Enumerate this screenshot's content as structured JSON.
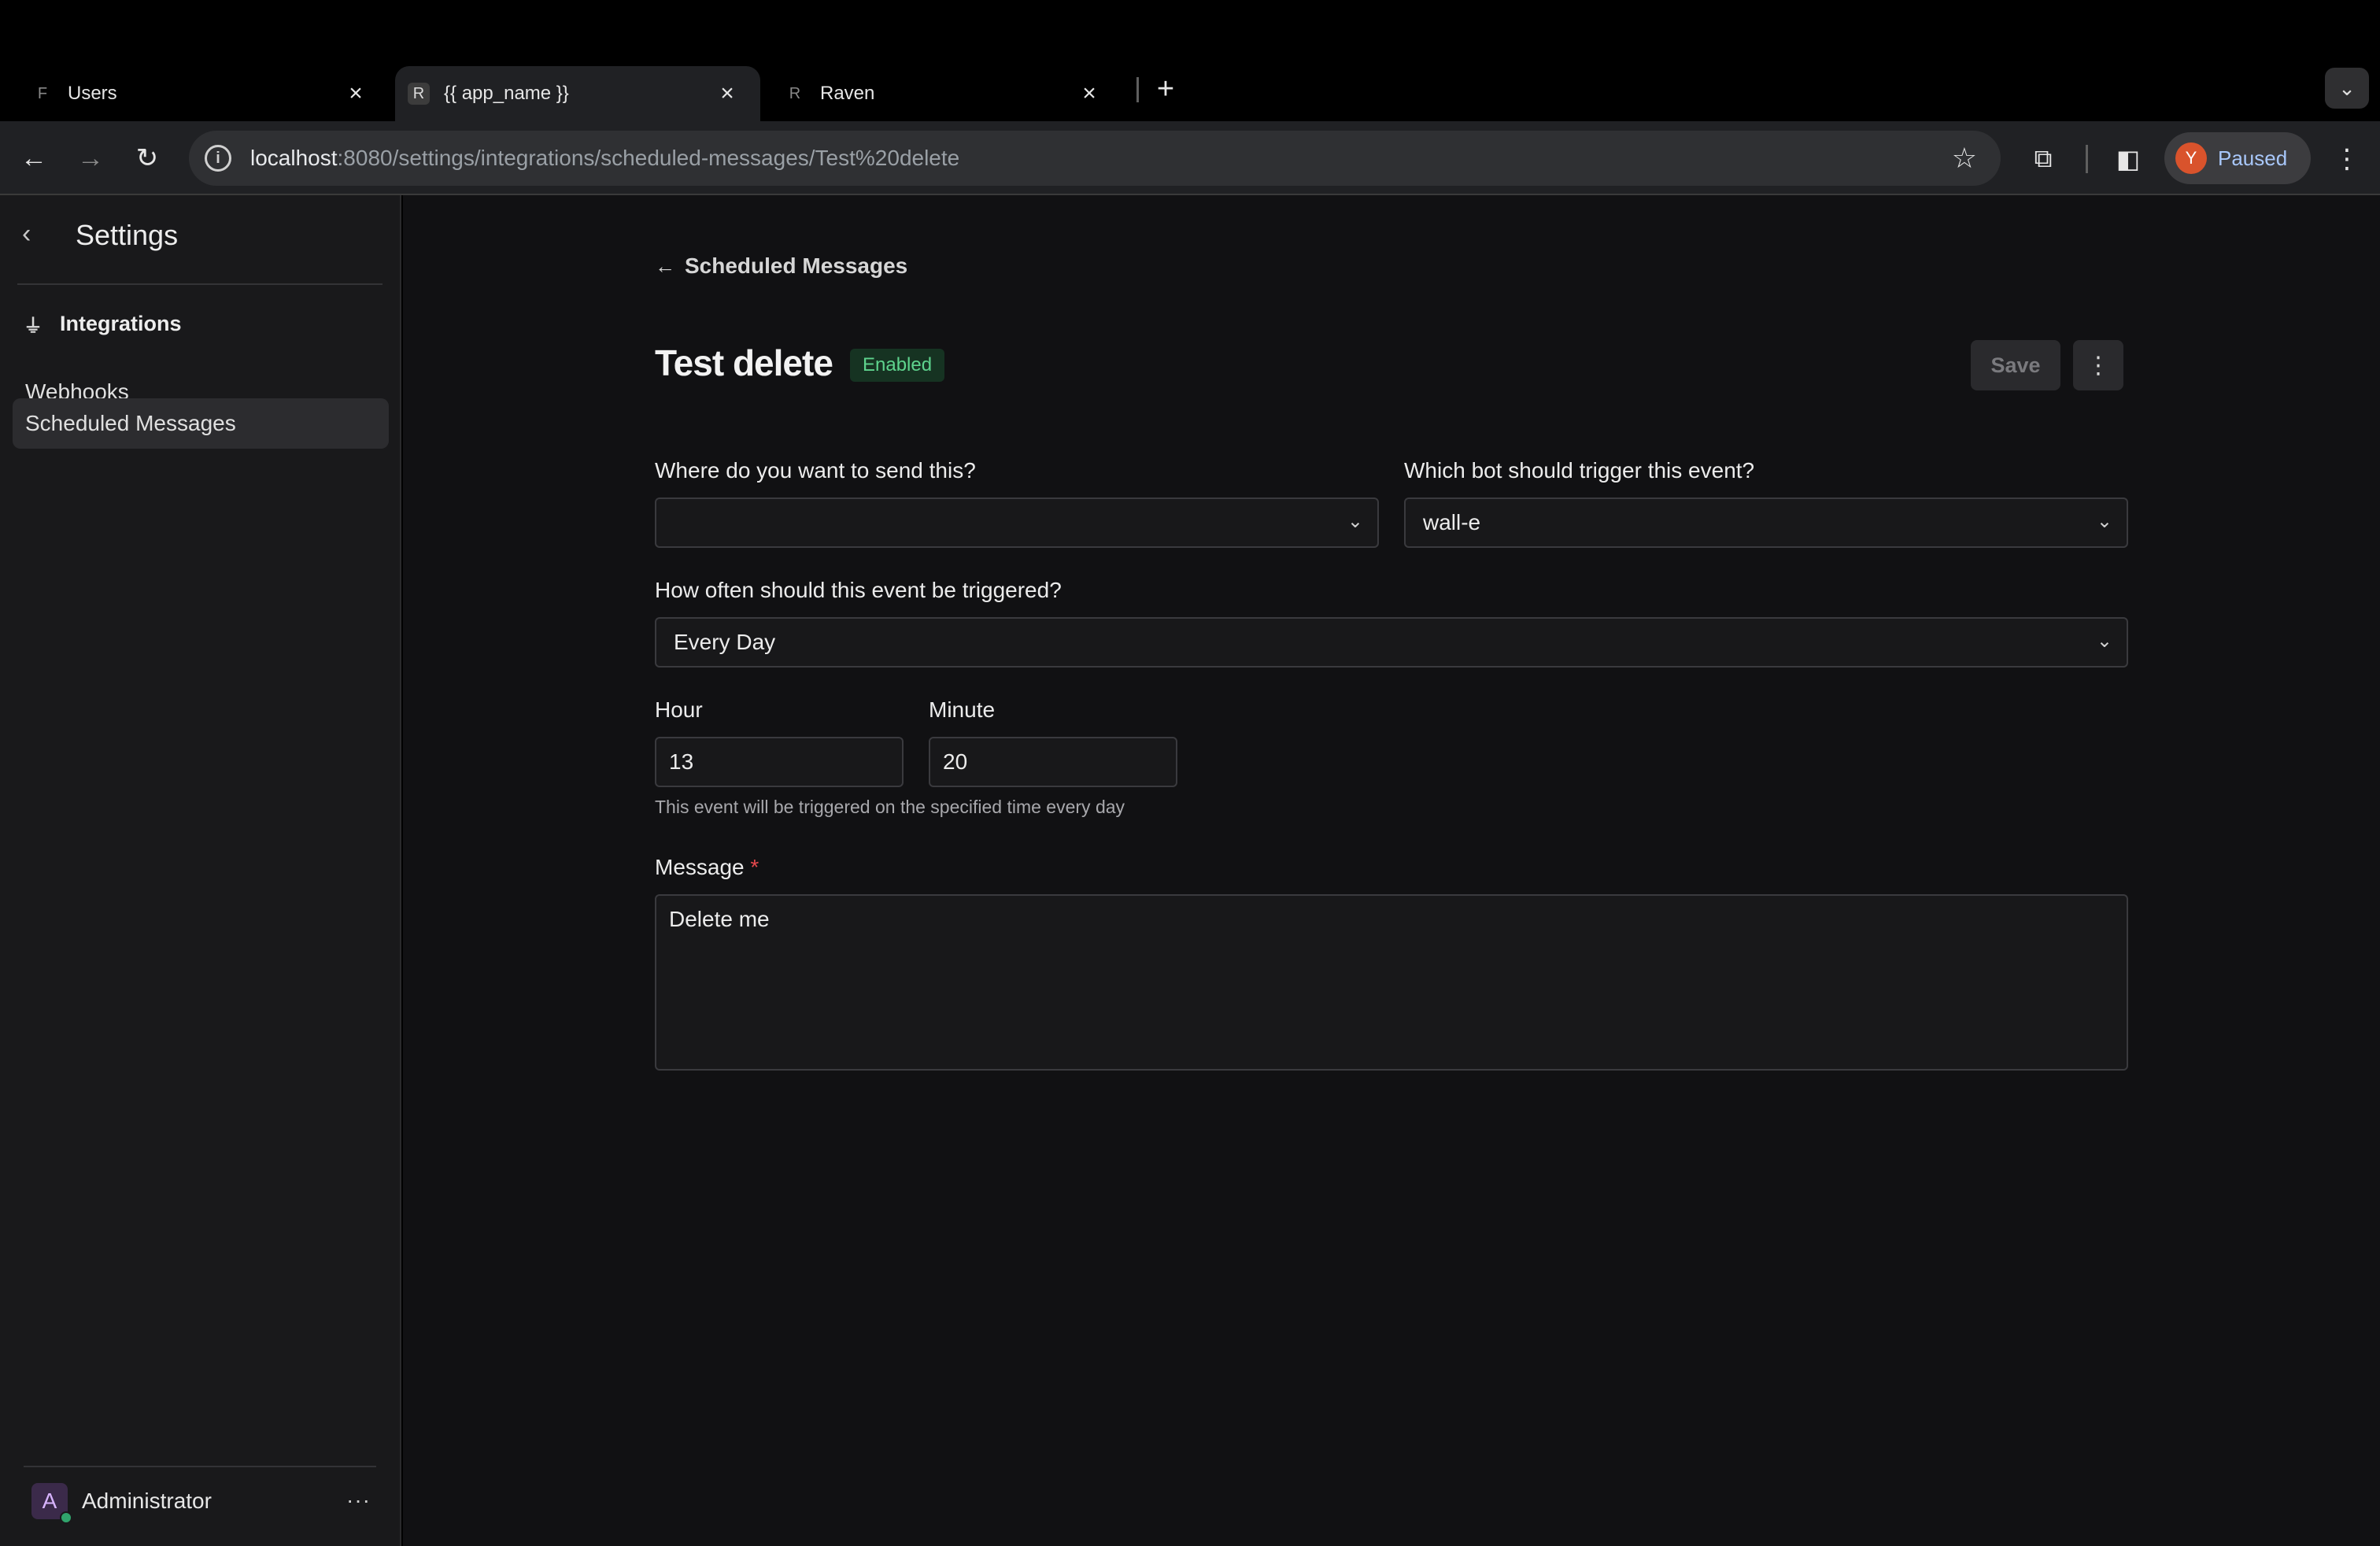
{
  "browser": {
    "tabs": [
      {
        "title": "Users",
        "favicon": "frappe-icon"
      },
      {
        "title": "{{ app_name }}",
        "favicon": "raven-icon"
      },
      {
        "title": "Raven",
        "favicon": "raven-icon"
      }
    ],
    "url_host": "localhost",
    "url_path": ":8080/settings/integrations/scheduled-messages/Test%20delete",
    "profile_initial": "Y",
    "profile_status": "Paused"
  },
  "sidebar": {
    "title": "Settings",
    "section_label": "Integrations",
    "items": [
      {
        "label": "Webhooks",
        "active": false
      },
      {
        "label": "Scheduled Messages",
        "active": true
      }
    ],
    "user": {
      "initial": "A",
      "name": "Administrator"
    }
  },
  "main": {
    "back_label": "Scheduled Messages",
    "title": "Test delete",
    "status_badge": "Enabled",
    "save_label": "Save",
    "form": {
      "channel_label": "Where do you want to send this?",
      "channel_value": "",
      "bot_label": "Which bot should trigger this event?",
      "bot_value": "wall-e",
      "frequency_label": "How often should this event be triggered?",
      "frequency_value": "Every Day",
      "hour_label": "Hour",
      "hour_value": "13",
      "minute_label": "Minute",
      "minute_value": "20",
      "time_hint": "This event will be triggered on the specified time every day",
      "message_label": "Message",
      "message_required": "*",
      "message_value": "Delete me"
    }
  }
}
